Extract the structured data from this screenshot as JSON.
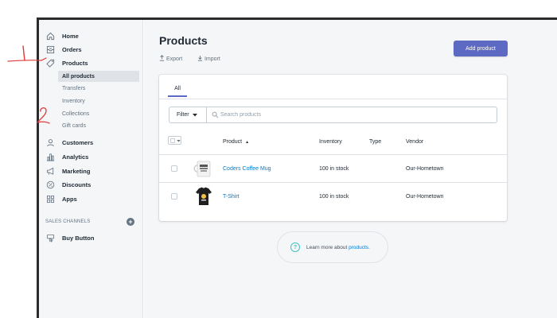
{
  "sidebar": {
    "items": [
      {
        "label": "Home",
        "icon": "home-icon"
      },
      {
        "label": "Orders",
        "icon": "orders-icon"
      },
      {
        "label": "Products",
        "icon": "tag-icon"
      },
      {
        "label": "Customers",
        "icon": "customers-icon"
      },
      {
        "label": "Analytics",
        "icon": "analytics-icon"
      },
      {
        "label": "Marketing",
        "icon": "marketing-icon"
      },
      {
        "label": "Discounts",
        "icon": "discounts-icon"
      },
      {
        "label": "Apps",
        "icon": "apps-icon"
      }
    ],
    "products_sub": [
      "All products",
      "Transfers",
      "Inventory",
      "Collections",
      "Gift cards"
    ],
    "sales_channels_label": "SALES CHANNELS",
    "sales_channels_add": "+",
    "buy_button": {
      "label": "Buy Button",
      "icon": "buy-button-icon"
    }
  },
  "header": {
    "title": "Products",
    "export_label": "Export",
    "import_label": "Import",
    "add_button_label": "Add product"
  },
  "tabs": [
    "All"
  ],
  "filter": {
    "button_label": "Filter",
    "search_placeholder": "Search products",
    "search_value": ""
  },
  "table": {
    "columns": [
      "Product",
      "Inventory",
      "Type",
      "Vendor"
    ],
    "sort_indicator": "▲",
    "rows": [
      {
        "product": "Coders Coffee Mug",
        "inventory": "100 in stock",
        "type": "",
        "vendor": "Our-Hometown",
        "thumb": "mug"
      },
      {
        "product": "T-Shirt",
        "inventory": "100 in stock",
        "type": "",
        "vendor": "Our-Hometown",
        "thumb": "tshirt"
      }
    ]
  },
  "learn_more": {
    "text": "Learn more about",
    "link": "products.",
    "icon": "?"
  },
  "annotations": [
    "1",
    "2"
  ],
  "colors": {
    "accent": "#5c6ac4",
    "link": "#007ace",
    "annotation": "#e03a3a",
    "sidebar_bg": "#f4f6f8"
  }
}
